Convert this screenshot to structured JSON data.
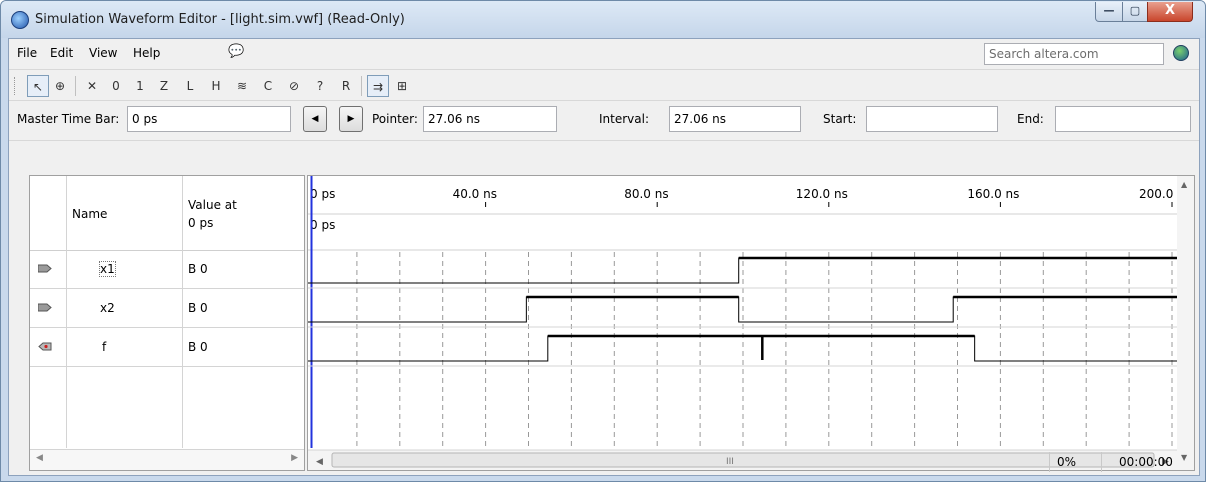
{
  "window": {
    "title": "Simulation Waveform Editor - [light.sim.vwf] (Read-Only)",
    "min_glyph": "—",
    "max_glyph": "▢",
    "close_glyph": "X"
  },
  "menu": [
    "File",
    "Edit",
    "View",
    "Help"
  ],
  "search": {
    "placeholder": "Search altera.com"
  },
  "toolbar": {
    "icons": [
      "pointer-icon",
      "zoom-icon",
      "uninitialized-icon",
      "forcing-low-icon",
      "forcing-high-icon",
      "high-impedance-icon",
      "weak-low-icon",
      "weak-high-icon",
      "invert-icon",
      "count-value-icon",
      "clock-value-icon",
      "arbitrary-value-icon",
      "random-value-icon",
      "snap-to-grid-icon",
      "group-icon"
    ]
  },
  "timebar": {
    "master_label": "Master Time Bar:",
    "master_value": "0 ps",
    "pointer_label": "Pointer:",
    "pointer_value": "27.06 ns",
    "interval_label": "Interval:",
    "interval_value": "27.06 ns",
    "start_label": "Start:",
    "start_value": "",
    "end_label": "End:",
    "end_value": ""
  },
  "table": {
    "col_name": "Name",
    "col_value": "Value at",
    "col_value_sub": "0 ps"
  },
  "signals": [
    {
      "name": "x1",
      "value": "B 0",
      "kind": "input",
      "transitions_ns": [
        99
      ]
    },
    {
      "name": "x2",
      "value": "B 0",
      "kind": "input",
      "transitions_ns": [
        49.5,
        99,
        149
      ]
    },
    {
      "name": "f",
      "value": "B 0",
      "kind": "output",
      "transitions_ns": [
        54.5,
        154
      ],
      "glitch_ns": 104.5
    }
  ],
  "timeline": {
    "ticks": [
      "0 ps",
      "40.0 ns",
      "80.0 ns",
      "120.0 ns",
      "160.0 ns",
      "200.0 ns"
    ],
    "tick_values_ns": [
      0,
      40,
      80,
      120,
      160,
      200
    ],
    "cursor_label": "0 ps",
    "visible_end_ns": 200
  },
  "status": {
    "progress": "0%",
    "elapsed": "00:00:00"
  },
  "colors": {
    "cursor": "#2233dd",
    "wave": "#000000"
  }
}
